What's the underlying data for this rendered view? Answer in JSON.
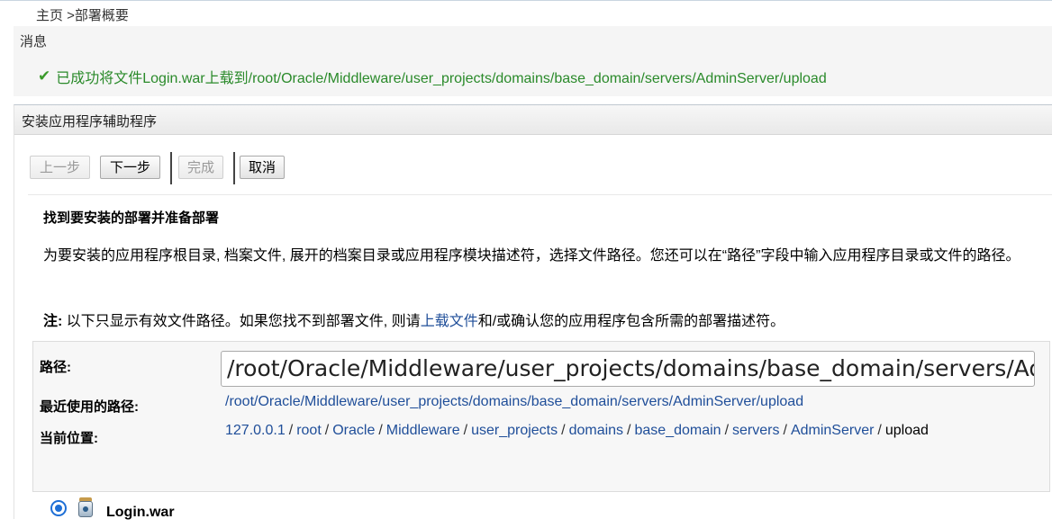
{
  "breadcrumb": {
    "text": "主页 >部署概要"
  },
  "messages": {
    "title": "消息",
    "success_text": "已成功将文件Login.war上载到/root/Oracle/Middleware/user_projects/domains/base_domain/servers/AdminServer/upload"
  },
  "panel": {
    "title": "安装应用程序辅助程序",
    "buttons": {
      "back": "上一步",
      "next": "下一步",
      "finish": "完成",
      "cancel": "取消"
    }
  },
  "content": {
    "heading": "找到要安装的部署并准备部署",
    "description": "为要安装的应用程序根目录, 档案文件, 展开的档案目录或应用程序模块描述符，选择文件路径。您还可以在“路径”字段中输入应用程序目录或文件的路径。",
    "note_label": "注:",
    "note_before": " 以下只显示有效文件路径。如果您找不到部署文件, 则请",
    "note_link": "上载文件",
    "note_after": "和/或确认您的应用程序包含所需的部署描述符。"
  },
  "form": {
    "path_label": "路径:",
    "path_value": "/root/Oracle/Middleware/user_projects/domains/base_domain/servers/AdminServer/upload",
    "recent_label": "最近使用的路径:",
    "recent_value": "/root/Oracle/Middleware/user_projects/domains/base_domain/servers/AdminServer/upload",
    "current_label": "当前位置:",
    "current_path": [
      "127.0.0.1",
      "root",
      "Oracle",
      "Middleware",
      "user_projects",
      "domains",
      "base_domain",
      "servers",
      "AdminServer"
    ],
    "current_last": "upload"
  },
  "file": {
    "name": "Login.war",
    "selected": true
  },
  "icons": {
    "success": "checkmark-icon",
    "radio": "radio-selected-icon",
    "file": "jar-file-icon"
  },
  "colors": {
    "success": "#2a8a2a",
    "link": "#1f4e99",
    "radio": "#1e6fd6"
  }
}
